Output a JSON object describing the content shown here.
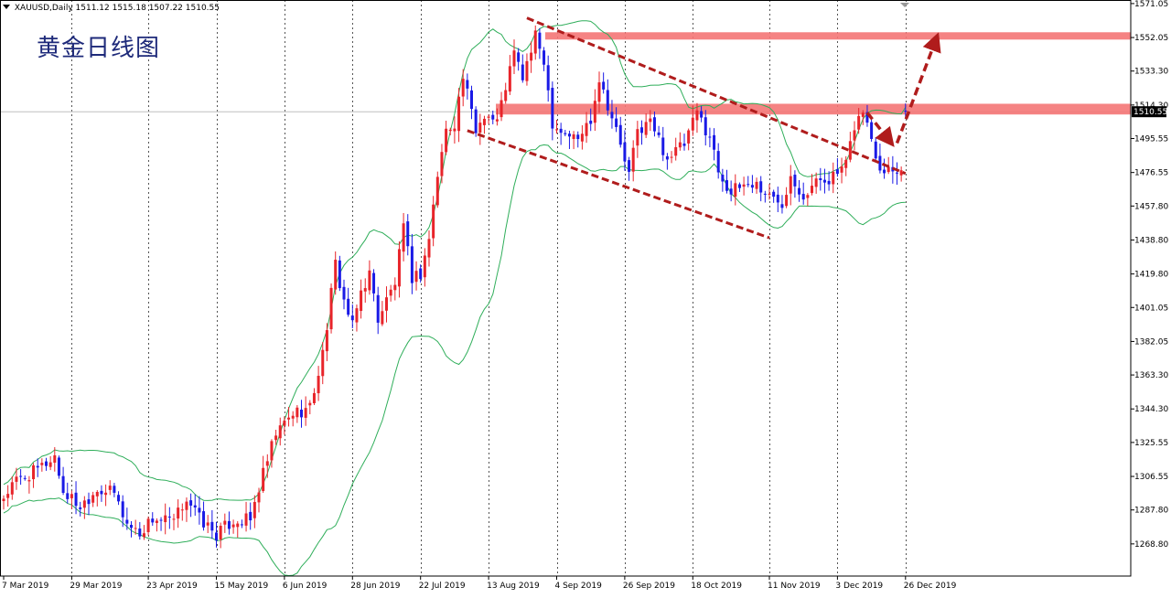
{
  "header": {
    "symbol": "XAUUSD,Daily",
    "ohlc": "1511.12 1515.18 1507.22 1510.55"
  },
  "title": "黄金日线图",
  "colors": {
    "bull": "#e8242a",
    "bear": "#1a1ae6",
    "band": "#2fae5a",
    "zone": "#f47676",
    "arrow": "#b01c1c",
    "grid": "#555555"
  },
  "chart_data": {
    "type": "candlestick",
    "symbol": "XAUUSD",
    "timeframe": "Daily",
    "current_price": 1510.55,
    "ylim": [
      1259.0,
      1571.0
    ],
    "ytick_labels": [
      "1571.05",
      "1552.05",
      "1533.30",
      "1514.30",
      "1495.55",
      "1476.55",
      "1457.80",
      "1438.80",
      "1419.80",
      "1401.05",
      "1382.05",
      "1363.30",
      "1344.30",
      "1325.55",
      "1306.55",
      "1287.80",
      "1268.80"
    ],
    "x_labels": [
      "7 Mar 2019",
      "29 Mar 2019",
      "23 Apr 2019",
      "15 May 2019",
      "6 Jun 2019",
      "28 Jun 2019",
      "22 Jul 2019",
      "13 Aug 2019",
      "4 Sep 2019",
      "26 Sep 2019",
      "18 Oct 2019",
      "11 Nov 2019",
      "3 Dec 2019",
      "26 Dec 2019"
    ],
    "x_label_index": [
      0,
      16,
      34,
      50,
      66,
      82,
      98,
      114,
      130,
      146,
      162,
      180,
      196,
      212
    ],
    "n_bars": 213,
    "price_keypoints": [
      [
        0,
        1295
      ],
      [
        3,
        1304
      ],
      [
        8,
        1310
      ],
      [
        12,
        1318
      ],
      [
        14,
        1298
      ],
      [
        18,
        1290
      ],
      [
        22,
        1300
      ],
      [
        26,
        1297
      ],
      [
        29,
        1280
      ],
      [
        32,
        1275
      ],
      [
        35,
        1283
      ],
      [
        40,
        1281
      ],
      [
        43,
        1295
      ],
      [
        46,
        1283
      ],
      [
        50,
        1274
      ],
      [
        54,
        1282
      ],
      [
        58,
        1282
      ],
      [
        60,
        1300
      ],
      [
        64,
        1330
      ],
      [
        68,
        1342
      ],
      [
        72,
        1345
      ],
      [
        75,
        1375
      ],
      [
        78,
        1425
      ],
      [
        80,
        1405
      ],
      [
        82,
        1390
      ],
      [
        84,
        1410
      ],
      [
        86,
        1420
      ],
      [
        88,
        1395
      ],
      [
        92,
        1415
      ],
      [
        94,
        1445
      ],
      [
        96,
        1418
      ],
      [
        98,
        1420
      ],
      [
        100,
        1440
      ],
      [
        102,
        1475
      ],
      [
        104,
        1500
      ],
      [
        106,
        1505
      ],
      [
        108,
        1530
      ],
      [
        111,
        1500
      ],
      [
        113,
        1510
      ],
      [
        116,
        1505
      ],
      [
        118,
        1525
      ],
      [
        120,
        1543
      ],
      [
        122,
        1530
      ],
      [
        125,
        1552
      ],
      [
        127,
        1540
      ],
      [
        129,
        1505
      ],
      [
        131,
        1500
      ],
      [
        135,
        1495
      ],
      [
        138,
        1507
      ],
      [
        140,
        1530
      ],
      [
        144,
        1500
      ],
      [
        147,
        1475
      ],
      [
        149,
        1500
      ],
      [
        152,
        1505
      ],
      [
        156,
        1485
      ],
      [
        160,
        1492
      ],
      [
        163,
        1510
      ],
      [
        166,
        1497
      ],
      [
        168,
        1478
      ],
      [
        171,
        1465
      ],
      [
        174,
        1470
      ],
      [
        177,
        1470
      ],
      [
        180,
        1463
      ],
      [
        183,
        1460
      ],
      [
        185,
        1476
      ],
      [
        188,
        1464
      ],
      [
        192,
        1473
      ],
      [
        195,
        1474
      ],
      [
        198,
        1480
      ],
      [
        200,
        1503
      ],
      [
        202,
        1511
      ],
      [
        206,
        1480
      ],
      [
        213,
        1478
      ]
    ],
    "bollinger_period": 20,
    "bollinger_dev": 2,
    "resistance_zones": [
      [
        1551,
        1555
      ],
      [
        1509,
        1515
      ]
    ],
    "annotations": {
      "channel_upper": [
        [
          123,
          1563
        ],
        [
          212,
          1476
        ]
      ],
      "channel_lower": [
        [
          109,
          1500
        ],
        [
          180,
          1440
        ]
      ],
      "arrow_short": [
        [
          203,
          1510
        ],
        [
          208,
          1495
        ]
      ],
      "arrow_long": [
        [
          210,
          1493
        ],
        [
          219,
          1550
        ]
      ]
    },
    "xlabel": "",
    "ylabel": ""
  }
}
